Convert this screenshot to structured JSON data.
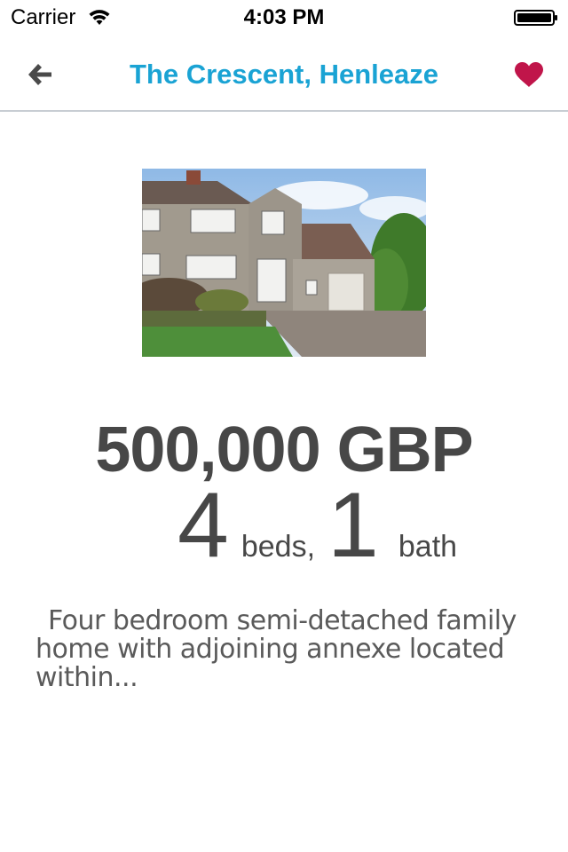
{
  "status_bar": {
    "carrier": "Carrier",
    "time": "4:03 PM",
    "icons": [
      "wifi-icon",
      "battery-icon"
    ]
  },
  "nav": {
    "title": "The Crescent, Henleaze",
    "back_icon": "arrow-left-icon",
    "favorite_icon": "heart-icon",
    "title_color": "#1aa3d4",
    "favorite_color": "#c0154a"
  },
  "listing": {
    "photo": "house-photo",
    "price": "500,000 GBP",
    "beds_count": "4",
    "beds_label": "beds,",
    "baths_count": "1",
    "baths_label": "bath",
    "description": "Four bedroom semi-detached family home with adjoining annexe located within..."
  }
}
